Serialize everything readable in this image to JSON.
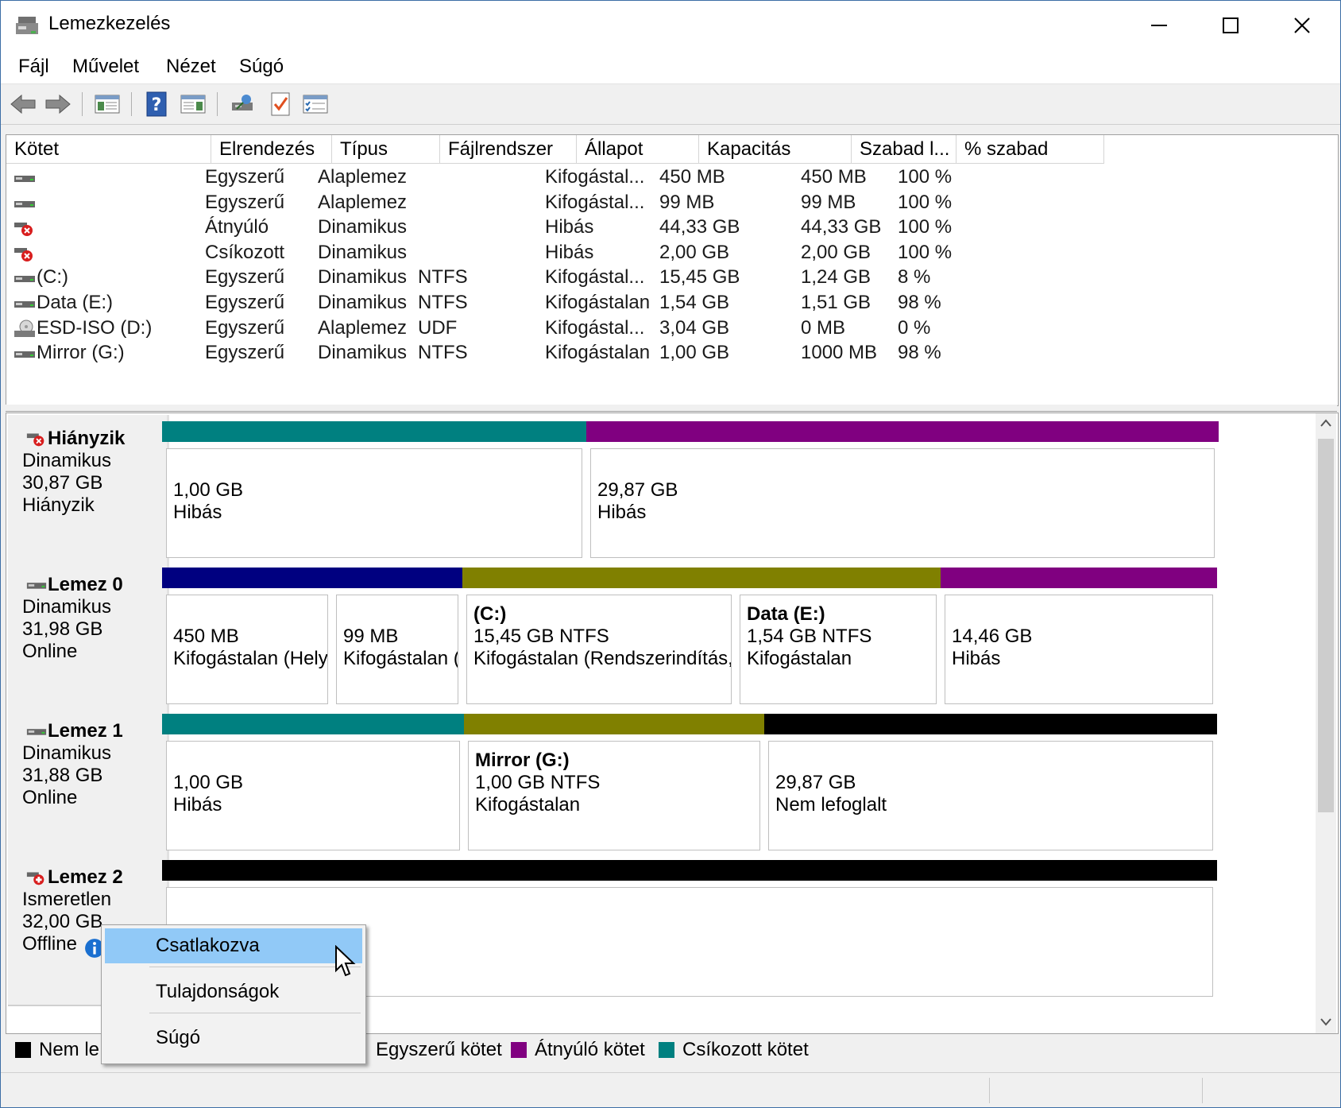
{
  "window": {
    "title": "Lemezkezelés"
  },
  "menu": [
    "Fájl",
    "Művelet",
    "Nézet",
    "Súgó"
  ],
  "toolbar": {
    "icons": [
      "back-arrow-icon",
      "forward-arrow-icon",
      "console-tree-icon",
      "help-icon",
      "action-pane-icon",
      "connect-icon",
      "check-icon",
      "properties-icon"
    ]
  },
  "volume_list": {
    "columns": [
      "Kötet",
      "Elrendezés",
      "Típus",
      "Fájlrendszer",
      "Állapot",
      "Kapacitás",
      "Szabad l...",
      "% szabad"
    ],
    "rows": [
      {
        "icon": "drive-icon",
        "volume": "",
        "layout": "Egyszerű",
        "type": "Alaplemez",
        "fs": "",
        "status": "Kifogástal...",
        "capacity": "450 MB",
        "free": "450 MB",
        "pct": "100 %"
      },
      {
        "icon": "drive-icon",
        "volume": "",
        "layout": "Egyszerű",
        "type": "Alaplemez",
        "fs": "",
        "status": "Kifogástal...",
        "capacity": "99 MB",
        "free": "99 MB",
        "pct": "100 %"
      },
      {
        "icon": "drive-error-icon",
        "volume": "",
        "layout": "Átnyúló",
        "type": "Dinamikus",
        "fs": "",
        "status": "Hibás",
        "capacity": "44,33 GB",
        "free": "44,33 GB",
        "pct": "100 %"
      },
      {
        "icon": "drive-error-icon",
        "volume": "",
        "layout": "Csíkozott",
        "type": "Dinamikus",
        "fs": "",
        "status": "Hibás",
        "capacity": "2,00 GB",
        "free": "2,00 GB",
        "pct": "100 %"
      },
      {
        "icon": "drive-icon",
        "volume": "(C:)",
        "layout": "Egyszerű",
        "type": "Dinamikus",
        "fs": "NTFS",
        "status": "Kifogástal...",
        "capacity": "15,45 GB",
        "free": "1,24 GB",
        "pct": "8 %"
      },
      {
        "icon": "drive-icon",
        "volume": "Data (E:)",
        "layout": "Egyszerű",
        "type": "Dinamikus",
        "fs": "NTFS",
        "status": "Kifogástalan",
        "capacity": "1,54 GB",
        "free": "1,51 GB",
        "pct": "98 %"
      },
      {
        "icon": "cd-drive-icon",
        "volume": "ESD-ISO (D:)",
        "layout": "Egyszerű",
        "type": "Alaplemez",
        "fs": "UDF",
        "status": "Kifogástal...",
        "capacity": "3,04 GB",
        "free": "0 MB",
        "pct": "0 %"
      },
      {
        "icon": "drive-icon",
        "volume": "Mirror (G:)",
        "layout": "Egyszerű",
        "type": "Dinamikus",
        "fs": "NTFS",
        "status": "Kifogástalan",
        "capacity": "1,00 GB",
        "free": "1000 MB",
        "pct": "98 %"
      }
    ]
  },
  "disks": [
    {
      "name": "Hiányzik",
      "lines": [
        "Dinamikus",
        "30,87 GB",
        "Hiányzik"
      ],
      "icon": "disk-error-icon",
      "parts": [
        {
          "color": "#008080",
          "lines": [
            "",
            "1,00 GB",
            "Hibás"
          ]
        },
        {
          "color": "#800080",
          "lines": [
            "",
            "29,87 GB",
            "Hibás"
          ]
        }
      ]
    },
    {
      "name": "Lemez 0",
      "lines": [
        "Dinamikus",
        "31,98 GB",
        "Online"
      ],
      "icon": "disk-icon",
      "parts": [
        {
          "color": "#000080",
          "lines": [
            "",
            "450 MB",
            "Kifogástalan (Helyr"
          ]
        },
        {
          "color": "#000080",
          "lines": [
            "",
            "99 MB",
            "Kifogástalan ("
          ]
        },
        {
          "color": "#808000",
          "lines": [
            "(C:)",
            "15,45 GB NTFS",
            "Kifogástalan (Rendszerindítás, La"
          ]
        },
        {
          "color": "#808000",
          "lines": [
            "Data  (E:)",
            "1,54 GB NTFS",
            "Kifogástalan"
          ]
        },
        {
          "color": "#800080",
          "lines": [
            "",
            "14,46 GB",
            "Hibás"
          ]
        }
      ]
    },
    {
      "name": "Lemez 1",
      "lines": [
        "Dinamikus",
        "31,88 GB",
        "Online"
      ],
      "icon": "disk-icon",
      "parts": [
        {
          "color": "#008080",
          "lines": [
            "",
            "1,00 GB",
            "Hibás"
          ]
        },
        {
          "color": "#808000",
          "lines": [
            "Mirror  (G:)",
            "1,00 GB NTFS",
            "Kifogástalan"
          ]
        },
        {
          "color": "#000000",
          "lines": [
            "",
            "29,87 GB",
            "Nem lefoglalt"
          ]
        }
      ]
    },
    {
      "name": "Lemez 2",
      "lines": [
        "Ismeretlen",
        "32,00 GB",
        "Offline"
      ],
      "icon": "disk-offline-icon",
      "parts": [
        {
          "color": "#000000",
          "lines": [
            "",
            "",
            ""
          ]
        }
      ]
    }
  ],
  "legend": [
    {
      "label": "Nem le",
      "color": "#000000"
    },
    {
      "label": "Egyszerű kötet",
      "color": "#808000"
    },
    {
      "label": "Átnyúló kötet",
      "color": "#800080"
    },
    {
      "label": "Csíkozott kötet",
      "color": "#008080"
    }
  ],
  "context_menu": {
    "items": [
      "Csatlakozva",
      "Tulajdonságok",
      "Súgó"
    ],
    "highlighted": 0
  }
}
